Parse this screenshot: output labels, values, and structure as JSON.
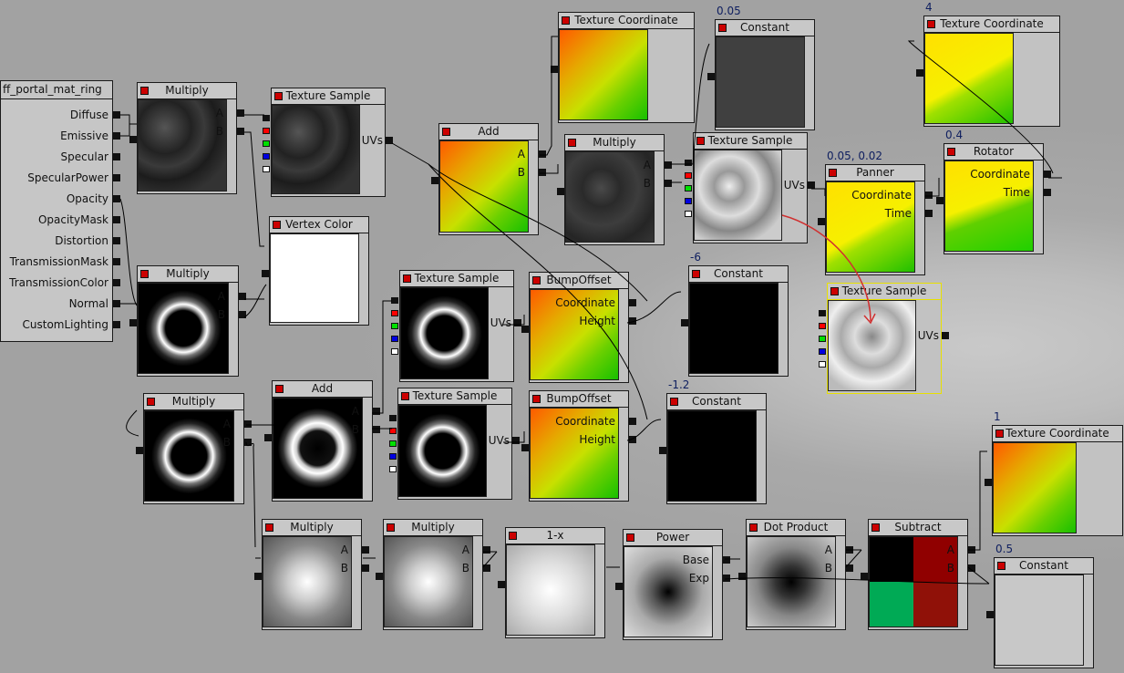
{
  "root": {
    "title": "ff_portal_mat_ring",
    "inputs": [
      "Diffuse",
      "Emissive",
      "Specular",
      "SpecularPower",
      "Opacity",
      "OpacityMask",
      "Distortion",
      "TransmissionMask",
      "TransmissionColor",
      "Normal",
      "CustomLighting"
    ]
  },
  "nodes": [
    {
      "id": "mul1",
      "title": "Multiply",
      "pins_in": [
        "A",
        "B"
      ],
      "preview": "noise-dark"
    },
    {
      "id": "tex1",
      "title": "Texture Sample",
      "pins_out": [
        "UVs"
      ],
      "preview": "noise-dark"
    },
    {
      "id": "vcol",
      "title": "Vertex Color",
      "preview": "white"
    },
    {
      "id": "mul2",
      "title": "Multiply",
      "pins_in": [
        "A",
        "B"
      ],
      "preview": "ring"
    },
    {
      "id": "mul3",
      "title": "Multiply",
      "pins_in": [
        "A",
        "B"
      ],
      "preview": "ring"
    },
    {
      "id": "add2",
      "title": "Add",
      "pins_in": [
        "A",
        "B"
      ],
      "preview": "ring-bright"
    },
    {
      "id": "tex2",
      "title": "Texture Sample",
      "pins_out": [
        "UVs"
      ],
      "preview": "ring"
    },
    {
      "id": "tex3",
      "title": "Texture Sample",
      "pins_out": [
        "UVs"
      ],
      "preview": "ring"
    },
    {
      "id": "bump1",
      "title": "BumpOffset",
      "pins_in": [
        "Coordinate",
        "Height"
      ],
      "preview": "uv"
    },
    {
      "id": "bump2",
      "title": "BumpOffset",
      "pins_in": [
        "Coordinate",
        "Height"
      ],
      "preview": "uv"
    },
    {
      "id": "const1",
      "title": "Constant",
      "value": "-6",
      "preview": "black"
    },
    {
      "id": "const2",
      "title": "Constant",
      "value": "-1.2",
      "preview": "black"
    },
    {
      "id": "add1",
      "title": "Add",
      "pins_in": [
        "A",
        "B"
      ],
      "preview": "uv"
    },
    {
      "id": "tc1",
      "title": "Texture Coordinate",
      "preview": "uv"
    },
    {
      "id": "mul4",
      "title": "Multiply",
      "pins_in": [
        "A",
        "B"
      ],
      "preview": "noise-dark2"
    },
    {
      "id": "const3",
      "title": "Constant",
      "value": "0.05",
      "preview": "gray"
    },
    {
      "id": "tex4",
      "title": "Texture Sample",
      "pins_out": [
        "UVs"
      ],
      "preview": "noise-light"
    },
    {
      "id": "pan",
      "title": "Panner",
      "value": "0.05, 0.02",
      "pins_in": [
        "Coordinate",
        "Time"
      ],
      "preview": "uv-yellow"
    },
    {
      "id": "tc2",
      "title": "Texture Coordinate",
      "value": "4",
      "preview": "uv-yellow"
    },
    {
      "id": "rot",
      "title": "Rotator",
      "value": "0.4",
      "pins_in": [
        "Coordinate",
        "Time"
      ],
      "preview": "uv-rot"
    },
    {
      "id": "tex5",
      "title": "Texture Sample",
      "pins_out": [
        "UVs"
      ],
      "preview": "clouds"
    },
    {
      "id": "tc3",
      "title": "Texture Coordinate",
      "value": "1",
      "preview": "uv"
    },
    {
      "id": "const4",
      "title": "Constant",
      "value": "0.5",
      "preview": "lightgray"
    },
    {
      "id": "mul5",
      "title": "Multiply",
      "pins_in": [
        "A",
        "B"
      ],
      "preview": "radial"
    },
    {
      "id": "mul6",
      "title": "Multiply",
      "pins_in": [
        "A",
        "B"
      ],
      "preview": "radial"
    },
    {
      "id": "oneminus",
      "title": "1-x",
      "preview": "radial-soft"
    },
    {
      "id": "pow",
      "title": "Power",
      "pins_in": [
        "Base",
        "Exp"
      ],
      "preview": "radial-dark"
    },
    {
      "id": "dot",
      "title": "Dot Product",
      "pins_in": [
        "A",
        "B"
      ],
      "preview": "radial-dark2"
    },
    {
      "id": "sub",
      "title": "Subtract",
      "pins_in": [
        "A",
        "B"
      ],
      "preview": "quad"
    }
  ],
  "colors": {
    "red": "#ff0000",
    "green": "#00e000",
    "blue": "#0000e0",
    "white": "#ffffff",
    "selection": "#e7e000",
    "wire": "#000000",
    "highlight_wire": "#d03030"
  }
}
